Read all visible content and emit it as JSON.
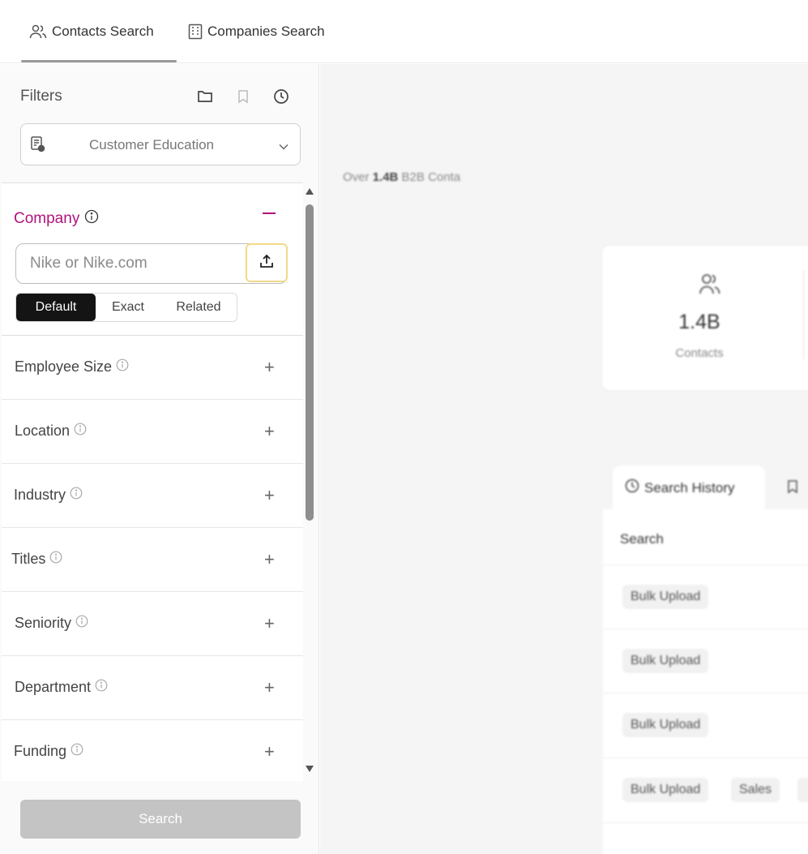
{
  "top_tabs": [
    {
      "label": "Contacts Search",
      "icon": "contacts-icon",
      "active": true
    },
    {
      "label": "Companies Search",
      "icon": "building-icon",
      "active": false
    }
  ],
  "sidebar": {
    "title": "Filters",
    "preset": {
      "selected": "Customer Education"
    },
    "company": {
      "label": "Company",
      "input_placeholder": "Nike or Nike.com",
      "input_value": "",
      "match_modes": [
        "Default",
        "Exact",
        "Related"
      ],
      "active_mode": "Default"
    },
    "filters": [
      {
        "label": "Employee Size"
      },
      {
        "label": "Location"
      },
      {
        "label": "Industry"
      },
      {
        "label": "Titles"
      },
      {
        "label": "Seniority"
      },
      {
        "label": "Department"
      },
      {
        "label": "Funding"
      }
    ],
    "search_label": "Search"
  },
  "main": {
    "tagline": {
      "prefix": "Over",
      "value": "1.4B",
      "suffix": "B2B Conta"
    },
    "stats": {
      "value": "1.4B",
      "label": "Contacts"
    },
    "history_tab_label": "Search History",
    "table_header": "Search",
    "rows": [
      [
        "Bulk Upload"
      ],
      [
        "Bulk Upload"
      ],
      [
        "Bulk Upload"
      ],
      [
        "Bulk Upload",
        "Sales"
      ]
    ]
  },
  "colors": {
    "accent": "#b0137a",
    "upload_border": "#f1d98a",
    "active_mode_bg": "#141414",
    "search_disabled": "#c4c4c4"
  }
}
